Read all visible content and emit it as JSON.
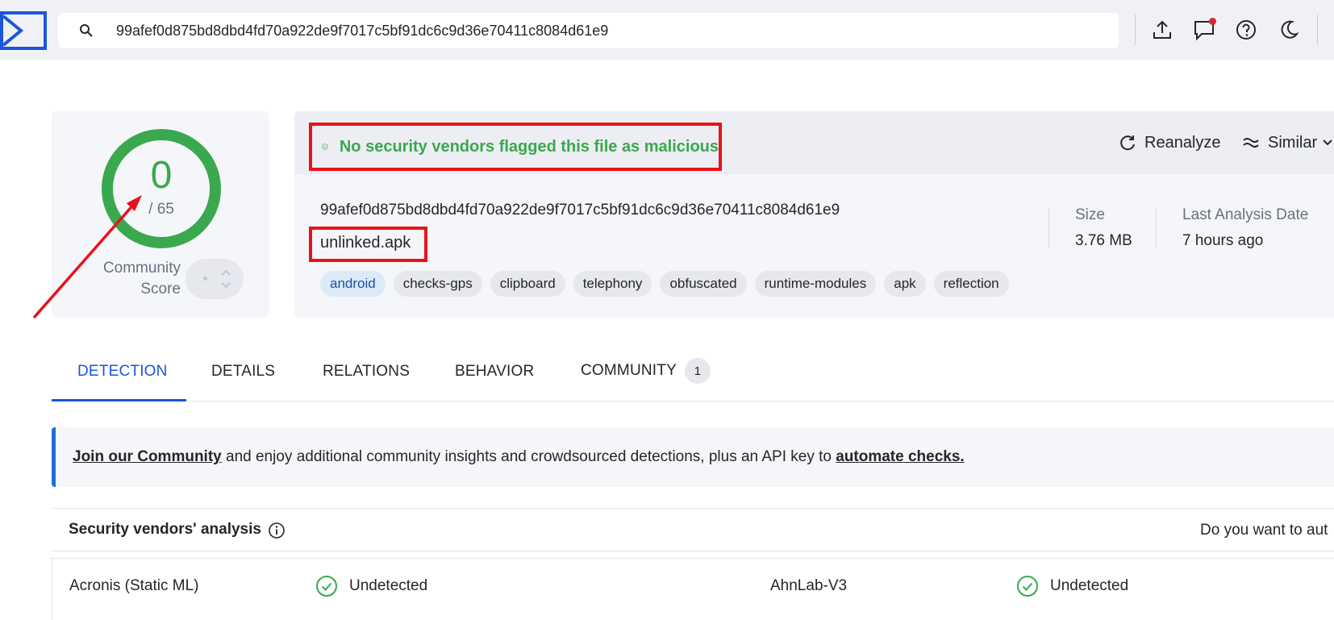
{
  "search": {
    "value": "99afef0d875bd8dbd4fd70a922de9f7017c5bf91dc6c9d36e70411c8084d61e9",
    "placeholder": ""
  },
  "score": {
    "value": "0",
    "total": "/ 65",
    "community_label_line1": "Community",
    "community_label_line2": "Score"
  },
  "verdict": {
    "text": "No security vendors flagged this file as malicious"
  },
  "actions": {
    "reanalyze": "Reanalyze",
    "similar": "Similar"
  },
  "file": {
    "hash": "99afef0d875bd8dbd4fd70a922de9f7017c5bf91dc6c9d36e70411c8084d61e9",
    "name": "unlinked.apk",
    "tags": [
      "android",
      "checks-gps",
      "clipboard",
      "telephony",
      "obfuscated",
      "runtime-modules",
      "apk",
      "reflection"
    ]
  },
  "meta": {
    "size_label": "Size",
    "size_value": "3.76 MB",
    "date_label": "Last Analysis Date",
    "date_value": "7 hours ago"
  },
  "tabs": {
    "detection": "DETECTION",
    "details": "DETAILS",
    "relations": "RELATIONS",
    "behavior": "BEHAVIOR",
    "community": "COMMUNITY",
    "community_count": "1"
  },
  "banner": {
    "link1": "Join our Community",
    "middle": " and enjoy additional community insights and crowdsourced detections, plus an API key to ",
    "link2": "automate checks."
  },
  "vendors": {
    "title": "Security vendors' analysis",
    "right_text": "Do you want to aut",
    "rows": [
      {
        "vendor1": "Acronis (Static ML)",
        "status1": "Undetected",
        "vendor2": "AhnLab-V3",
        "status2": "Undetected"
      }
    ]
  },
  "colors": {
    "accent": "#1a56db",
    "clean": "#3aa84e",
    "annotation": "#e8121b"
  }
}
